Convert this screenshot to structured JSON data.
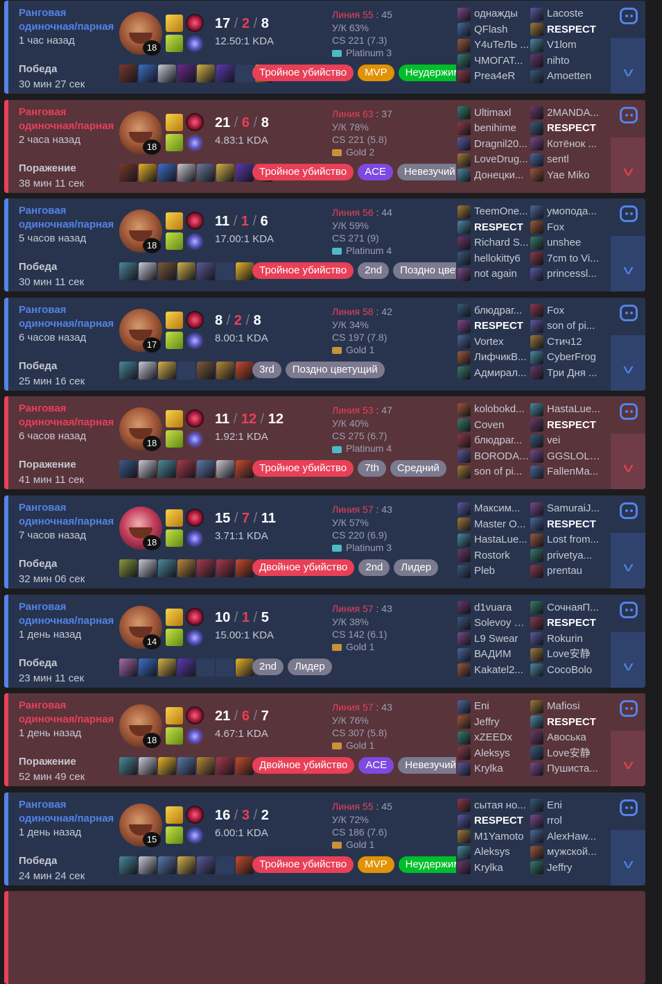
{
  "colors": {
    "win_bg": "#28344e",
    "loss_bg": "#59343b",
    "win_accent": "#5383e8",
    "loss_accent": "#e84057"
  },
  "matches": [
    {
      "result_type": "win",
      "mode": "Ранговая одиночная/парная",
      "ago": "1 час назад",
      "result": "Победа",
      "duration": "30 мин 27 сек",
      "champion": "graves",
      "level": "18",
      "kda": {
        "k": "17",
        "d": "2",
        "a": "8"
      },
      "ratio": "12.50:1 KDA",
      "lane_label": "Линия 55",
      "lane_num": "45",
      "kp": "У/К 63%",
      "cs": "CS 221 (7.3)",
      "rank": "Platinum 3",
      "rank_icon": "plat",
      "items": [
        "#7a3a2a",
        "#3d6fc9",
        "#c9c9d4",
        "#6b2a8a",
        "#d4b24a",
        "#5a3ab0",
        "empty",
        "#e6b52a"
      ],
      "badges": [
        {
          "text": "Тройное убийство",
          "kind": "kill"
        },
        {
          "text": "MVP",
          "kind": "mvp"
        },
        {
          "text": "Неудержимый",
          "kind": "green"
        }
      ],
      "team1": [
        "однажды",
        "QFlash",
        "Y4uTeЛЬ ...",
        "ЧМОГАТ...",
        "Prea4eR"
      ],
      "team2": [
        "Lacoste",
        "RESPECT",
        "V1lom",
        "nihto",
        "Amoetten"
      ],
      "me_team": 2,
      "me_index": 1
    },
    {
      "result_type": "loss",
      "mode": "Ранговая одиночная/парная",
      "ago": "2 часа назад",
      "result": "Поражение",
      "duration": "38 мин 11 сек",
      "champion": "graves",
      "level": "18",
      "kda": {
        "k": "21",
        "d": "6",
        "a": "8"
      },
      "ratio": "4.83:1 KDA",
      "lane_label": "Линия 63",
      "lane_num": "37",
      "kp": "У/К 78%",
      "cs": "CS 221 (5.8)",
      "rank": "Gold 2",
      "rank_icon": "gold",
      "items": [
        "#7a3a2a",
        "#e6b52a",
        "#3d6fc9",
        "#c9c9d4",
        "#6b7a9a",
        "#d4b24a",
        "#5a3ab0",
        "#c94a2a"
      ],
      "badges": [
        {
          "text": "Тройное убийство",
          "kind": "kill"
        },
        {
          "text": "ACE",
          "kind": "ace"
        },
        {
          "text": "Невезучий",
          "kind": "gray"
        }
      ],
      "team1": [
        "Ultimaxl",
        "benihime",
        "Dragnil20...",
        "LoveDrug...",
        "Донецки..."
      ],
      "team2": [
        "2MANDA...",
        "RESPECT",
        "Котёнок ...",
        "sentl",
        "Yae Miko"
      ],
      "me_team": 2,
      "me_index": 1
    },
    {
      "result_type": "win",
      "mode": "Ранговая одиночная/парная",
      "ago": "5 часов назад",
      "result": "Победа",
      "duration": "30 мин 11 сек",
      "champion": "graves",
      "level": "18",
      "kda": {
        "k": "11",
        "d": "1",
        "a": "6"
      },
      "ratio": "17.00:1 KDA",
      "lane_label": "Линия 56",
      "lane_num": "44",
      "kp": "У/К 59%",
      "cs": "CS 271 (9)",
      "rank": "Platinum 4",
      "rank_icon": "plat",
      "items": [
        "#4a8a9a",
        "#c9c9d4",
        "#7a5a3a",
        "#d4b24a",
        "#5a5a9a",
        "empty",
        "#e6b52a"
      ],
      "badges": [
        {
          "text": "Тройное убийство",
          "kind": "kill"
        },
        {
          "text": "2nd",
          "kind": "gray"
        },
        {
          "text": "Поздно цветущий",
          "kind": "gray"
        }
      ],
      "team1": [
        "TeemOne...",
        "RESPECT",
        "Richard S...",
        "hellokitty6",
        "not again"
      ],
      "team2": [
        "умопода...",
        "Fox",
        "unshee",
        "7cm to Vi...",
        "princessl..."
      ],
      "me_team": 1,
      "me_index": 1
    },
    {
      "result_type": "win",
      "mode": "Ранговая одиночная/парная",
      "ago": "6 часов назад",
      "result": "Победа",
      "duration": "25 мин 16 сек",
      "champion": "graves",
      "level": "17",
      "kda": {
        "k": "8",
        "d": "2",
        "a": "8"
      },
      "ratio": "8.00:1 KDA",
      "lane_label": "Линия 58",
      "lane_num": "42",
      "kp": "У/К 34%",
      "cs": "CS 197 (7.8)",
      "rank": "Gold 1",
      "rank_icon": "gold",
      "items": [
        "#4a8a9a",
        "#c9c9d4",
        "#d4b24a",
        "empty",
        "#7a5a3a",
        "#b88a3a",
        "#c94a2a"
      ],
      "badges": [
        {
          "text": "3rd",
          "kind": "gray"
        },
        {
          "text": "Поздно цветущий",
          "kind": "gray"
        }
      ],
      "team1": [
        "блюдраг...",
        "RESPECT",
        "Vortex",
        "ЛифчикВ...",
        "Адмирал..."
      ],
      "team2": [
        "Fox",
        "son of pi...",
        "Стич12",
        "CyberFrog",
        "Три Дня ..."
      ],
      "me_team": 1,
      "me_index": 1
    },
    {
      "result_type": "loss",
      "mode": "Ранговая одиночная/парная",
      "ago": "6 часов назад",
      "result": "Поражение",
      "duration": "41 мин 11 сек",
      "champion": "graves",
      "level": "18",
      "kda": {
        "k": "11",
        "d": "12",
        "a": "12"
      },
      "ratio": "1.92:1 KDA",
      "lane_label": "Линия 53",
      "lane_num": "47",
      "kp": "У/К 40%",
      "cs": "CS 275 (6.7)",
      "rank": "Platinum 4",
      "rank_icon": "plat",
      "items": [
        "#3a5a8a",
        "#c9c9d4",
        "#4a8a9a",
        "#a83a4a",
        "#5a7aaa",
        "#c9c9d4",
        "#c94a2a"
      ],
      "badges": [
        {
          "text": "Тройное убийство",
          "kind": "kill"
        },
        {
          "text": "7th",
          "kind": "gray"
        },
        {
          "text": "Средний",
          "kind": "gray"
        }
      ],
      "team1": [
        "kolobokd...",
        "Coven",
        "блюдраг...",
        "BORODA ...",
        "son of pi..."
      ],
      "team2": [
        "HastaLue...",
        "RESPECT",
        "vei",
        "GGSLOL2...",
        "FallenMa..."
      ],
      "me_team": 2,
      "me_index": 1
    },
    {
      "result_type": "win",
      "mode": "Ранговая одиночная/парная",
      "ago": "7 часов назад",
      "result": "Победа",
      "duration": "32 мин 06 сек",
      "champion": "vi",
      "level": "18",
      "kda": {
        "k": "15",
        "d": "7",
        "a": "11"
      },
      "ratio": "3.71:1 KDA",
      "lane_label": "Линия 57",
      "lane_num": "43",
      "kp": "У/К 57%",
      "cs": "CS 220 (6.9)",
      "rank": "Platinum 3",
      "rank_icon": "plat",
      "items": [
        "#8a9a3a",
        "#c9c9d4",
        "#4a8a9a",
        "#b88a3a",
        "#a83a4a",
        "#a83a4a",
        "#c94a2a"
      ],
      "badges": [
        {
          "text": "Двойное убийство",
          "kind": "kill"
        },
        {
          "text": "2nd",
          "kind": "gray"
        },
        {
          "text": "Лидер",
          "kind": "gray"
        }
      ],
      "team1": [
        "Максим...",
        "Master O...",
        "HastaLue...",
        "Rostork",
        "Pleb"
      ],
      "team2": [
        "SamuraiJ...",
        "RESPECT",
        "Lost from...",
        "privetya...",
        "prentau"
      ],
      "me_team": 2,
      "me_index": 1
    },
    {
      "result_type": "win",
      "mode": "Ранговая одиночная/парная",
      "ago": "1 день назад",
      "result": "Победа",
      "duration": "23 мин 11 сек",
      "champion": "graves",
      "level": "14",
      "kda": {
        "k": "10",
        "d": "1",
        "a": "5"
      },
      "ratio": "15.00:1 KDA",
      "lane_label": "Линия 57",
      "lane_num": "43",
      "kp": "У/К 38%",
      "cs": "CS 142 (6.1)",
      "rank": "Gold 1",
      "rank_icon": "gold",
      "items": [
        "#a86aa8",
        "#3d6fc9",
        "#d4b24a",
        "#5a3ab0",
        "empty",
        "empty",
        "#e6b52a"
      ],
      "badges": [
        {
          "text": "2nd",
          "kind": "gray"
        },
        {
          "text": "Лидер",
          "kind": "gray"
        }
      ],
      "team1": [
        "d1vuara",
        "Solevoy S...",
        "L9 Swear",
        "ВАДИМ",
        "Kakatel2..."
      ],
      "team2": [
        "СочнаяП...",
        "RESPECT",
        "Rokurin",
        "Love安静",
        "CocoBolo"
      ],
      "me_team": 2,
      "me_index": 1
    },
    {
      "result_type": "loss",
      "mode": "Ранговая одиночная/парная",
      "ago": "1 день назад",
      "result": "Поражение",
      "duration": "52 мин 49 сек",
      "champion": "graves",
      "level": "18",
      "kda": {
        "k": "21",
        "d": "6",
        "a": "7"
      },
      "ratio": "4.67:1 KDA",
      "lane_label": "Линия 57",
      "lane_num": "43",
      "kp": "У/К 76%",
      "cs": "CS 307 (5.8)",
      "rank": "Gold 1",
      "rank_icon": "gold",
      "items": [
        "#4a8a9a",
        "#c9c9d4",
        "#e6b52a",
        "#5a7aaa",
        "#b88a3a",
        "#a83a4a",
        "#c94a2a"
      ],
      "badges": [
        {
          "text": "Двойное убийство",
          "kind": "kill"
        },
        {
          "text": "ACE",
          "kind": "ace"
        },
        {
          "text": "Невезучий",
          "kind": "gray"
        }
      ],
      "team1": [
        "Eni",
        "Jeffry",
        "xZEEDx",
        "Aleksys",
        "Krylka"
      ],
      "team2": [
        "Mafiosi",
        "RESPECT",
        "Авоська",
        "Love安静",
        "Пушиста..."
      ],
      "me_team": 2,
      "me_index": 1
    },
    {
      "result_type": "win",
      "mode": "Ранговая одиночная/парная",
      "ago": "1 день назад",
      "result": "Победа",
      "duration": "24 мин 24 сек",
      "champion": "graves",
      "level": "15",
      "kda": {
        "k": "16",
        "d": "3",
        "a": "2"
      },
      "ratio": "6.00:1 KDA",
      "lane_label": "Линия 55",
      "lane_num": "45",
      "kp": "У/К 72%",
      "cs": "CS 186 (7.6)",
      "rank": "Gold 1",
      "rank_icon": "gold",
      "items": [
        "#4a8a9a",
        "#c9c9d4",
        "#5a7aaa",
        "#d4b24a",
        "#5a5a9a",
        "empty",
        "#c94a2a"
      ],
      "badges": [
        {
          "text": "Тройное убийство",
          "kind": "kill"
        },
        {
          "text": "MVP",
          "kind": "mvp"
        },
        {
          "text": "Неудержимый",
          "kind": "green"
        }
      ],
      "team1": [
        "сытая но...",
        "RESPECT",
        "M1Yamoto",
        "Aleksys",
        "Krylka"
      ],
      "team2": [
        "Eni",
        "rrol",
        "AlexHaw...",
        "мужской...",
        "Jeffry"
      ],
      "me_team": 1,
      "me_index": 1
    }
  ]
}
